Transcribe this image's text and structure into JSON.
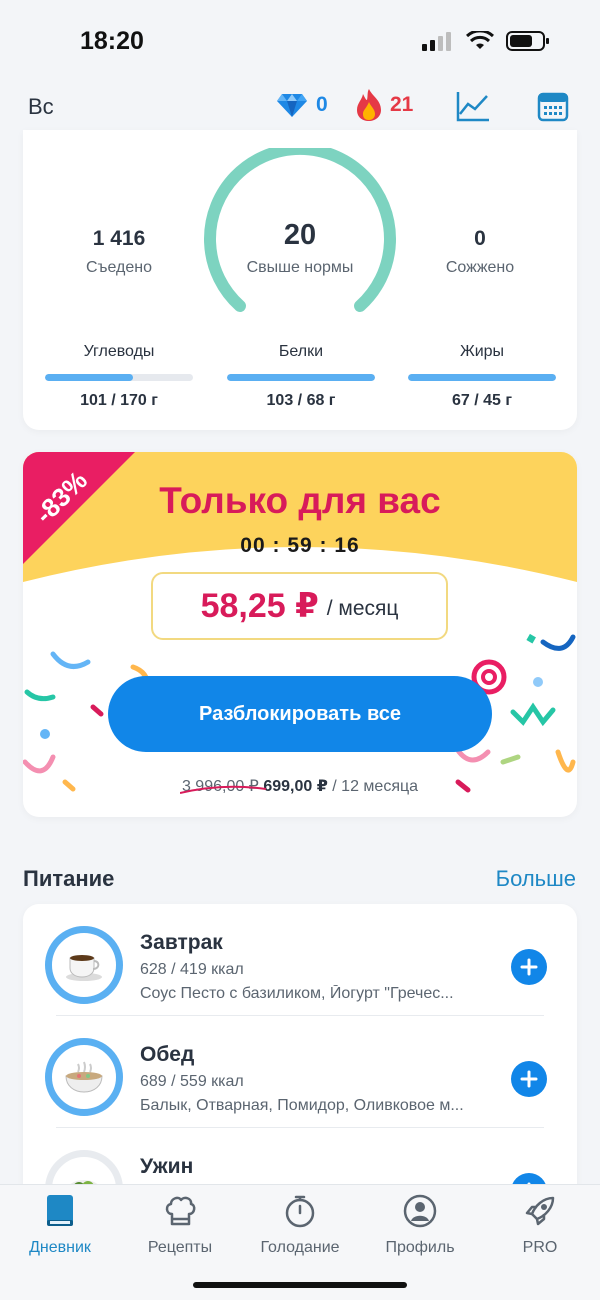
{
  "status_bar": {
    "time": "18:20"
  },
  "top_bar": {
    "day": "Вс",
    "gems": "0",
    "streak": "21",
    "icons": [
      "diamond-icon",
      "fire-icon",
      "chart-icon",
      "calendar-icon"
    ]
  },
  "summary": {
    "eaten": {
      "value": "1 416",
      "label": "Съедено"
    },
    "over": {
      "value": "20",
      "label": "Свыше нормы"
    },
    "burned": {
      "value": "0",
      "label": "Сожжено"
    },
    "macros": [
      {
        "name": "Углеводы",
        "value": "101 / 170 г",
        "progress": 0.594
      },
      {
        "name": "Белки",
        "value": "103 / 68 г",
        "progress": 1.0
      },
      {
        "name": "Жиры",
        "value": "67 / 45 г",
        "progress": 1.0
      }
    ]
  },
  "promo": {
    "discount": "-83%",
    "title": "Только для вас",
    "timer": "00 : 59 : 16",
    "price": "58,25 ₽",
    "period": "/ месяц",
    "button": "Разблокировать все",
    "old_price": "3 996,00 ₽",
    "new_price": "699,00 ₽",
    "term": "/ 12 месяца"
  },
  "nutrition": {
    "title": "Питание",
    "more": "Больше",
    "meals": [
      {
        "name": "Завтрак",
        "kcal": "628 / 419 ккал",
        "items": "Соус Песто с базиликом, Йогурт \"Гречес...",
        "icon": "coffee-cup-icon"
      },
      {
        "name": "Обед",
        "kcal": "689 / 559 ккал",
        "items": "Балык, Отварная, Помидор, Оливковое м...",
        "icon": "soup-bowl-icon"
      },
      {
        "name": "Ужин",
        "kcal": "",
        "items": "",
        "icon": "salad-icon"
      }
    ]
  },
  "tabs": [
    {
      "label": "Дневник",
      "icon": "book-icon",
      "active": true
    },
    {
      "label": "Рецепты",
      "icon": "chef-hat-icon"
    },
    {
      "label": "Голодание",
      "icon": "stopwatch-icon"
    },
    {
      "label": "Профиль",
      "icon": "profile-icon"
    },
    {
      "label": "PRO",
      "icon": "rocket-icon"
    }
  ],
  "colors": {
    "accent": "#1186e8",
    "promo_yellow": "#fdd35c",
    "promo_pink": "#d81b5a",
    "gauge": "#7dd3c0",
    "macro_bar": "#5aaff2"
  }
}
